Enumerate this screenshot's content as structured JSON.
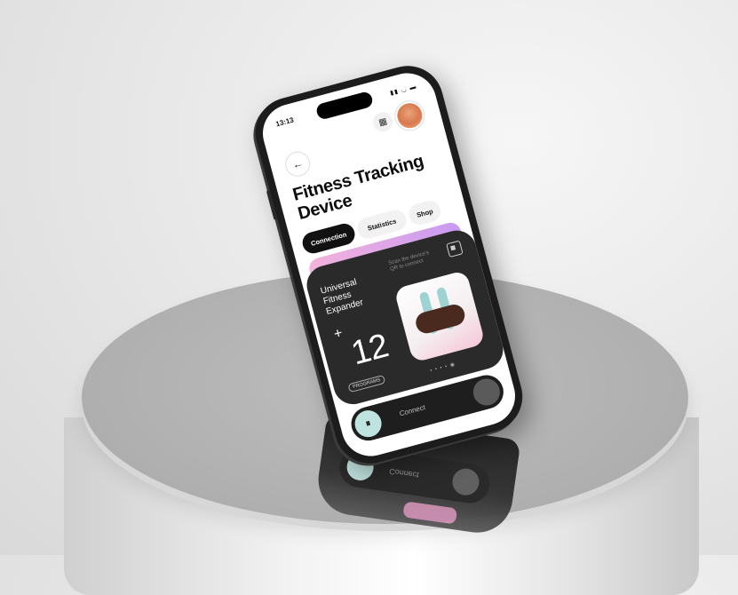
{
  "status": {
    "time": "13:13",
    "icons": "▮▮ ◡ ▬"
  },
  "header": {
    "calendar_icon": "calendar-icon",
    "avatar_icon": "avatar"
  },
  "page": {
    "back_glyph": "←",
    "title": "Fitness Tracking Device"
  },
  "tabs": [
    {
      "label": "Connection",
      "active": true
    },
    {
      "label": "Statistics",
      "active": false
    },
    {
      "label": "Shop",
      "active": false
    }
  ],
  "card": {
    "title": "Universal Fitness Expander",
    "scan_hint": "Scan the device's QR to connect",
    "plus": "+",
    "count": "12",
    "badge": "PROGRAMS",
    "dots": "• • • • ◉"
  },
  "connect": {
    "label": "Connect",
    "icon_glyph": "⏸"
  },
  "colors": {
    "accent_mint": "#bfe3df",
    "pink": "#f3b3db",
    "lavender": "#c99af2",
    "card_dark": "#2a2a2a"
  }
}
